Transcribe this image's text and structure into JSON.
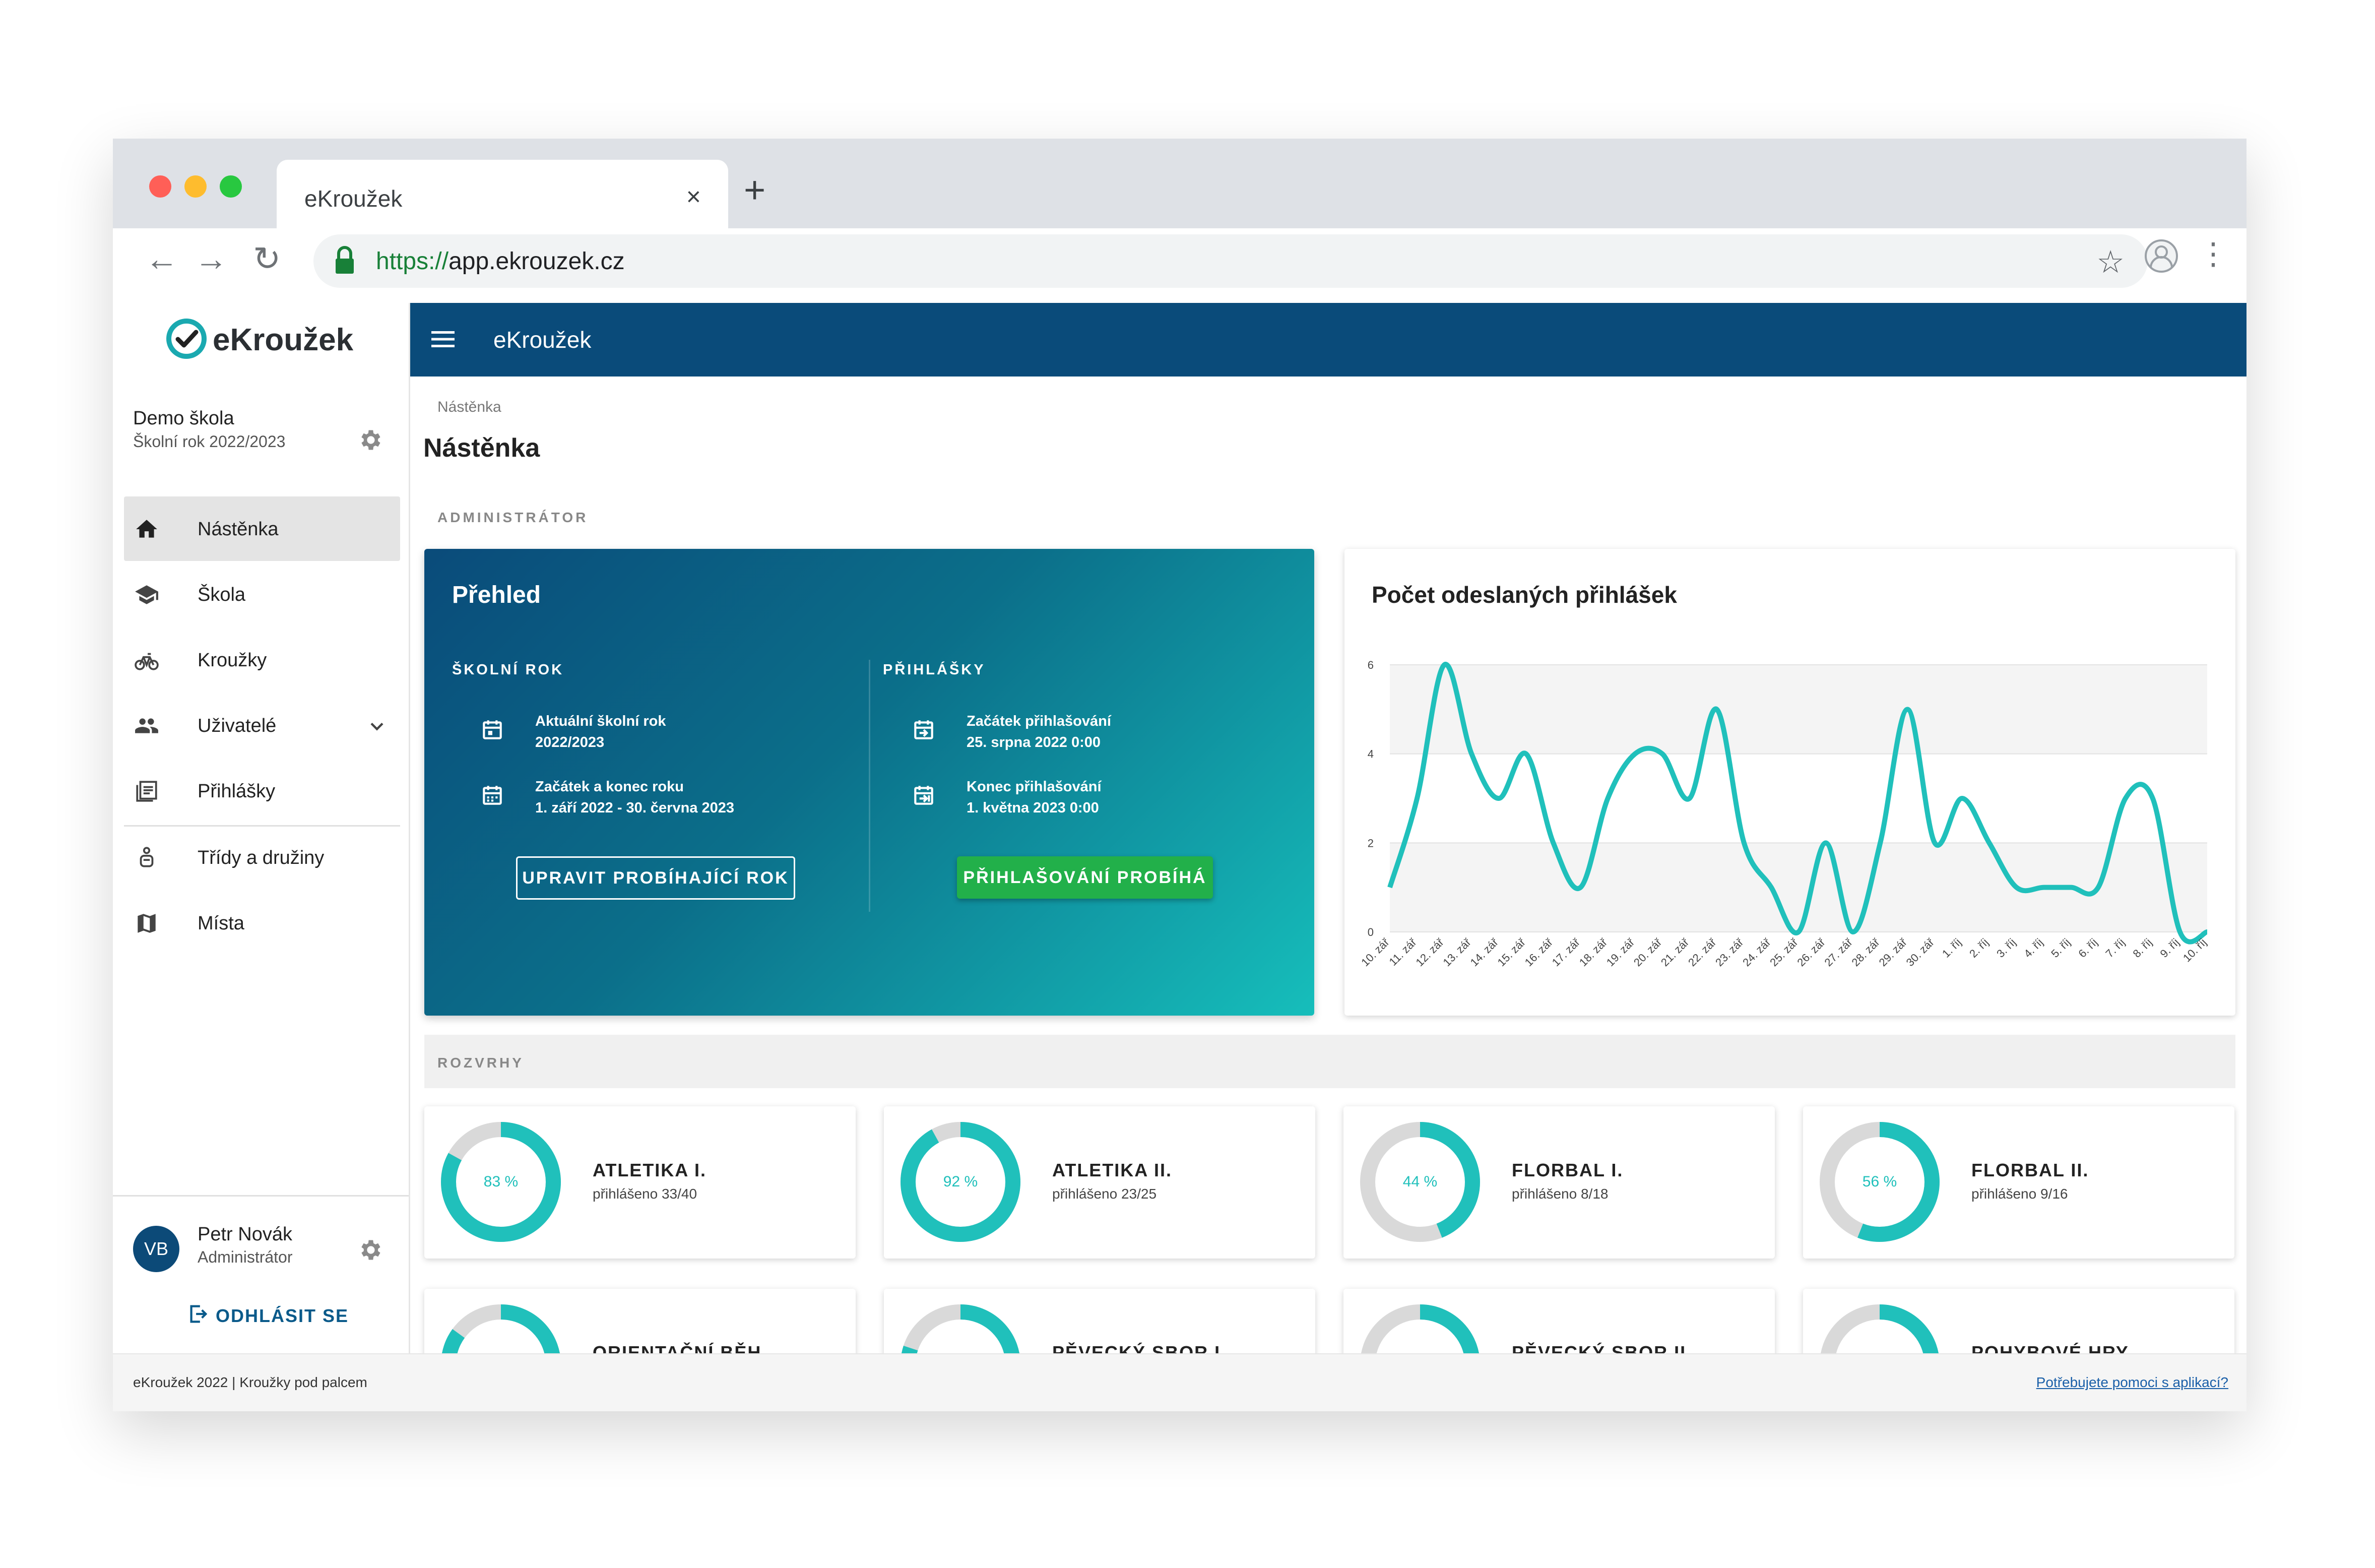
{
  "browser": {
    "tab_title": "eKroužek",
    "tab_close": "×",
    "new_tab": "+",
    "url_protocol": "https://",
    "url_rest": "app.ekrouzek.cz",
    "colors": {
      "red": "#ff5f57",
      "yellow": "#febc2e",
      "green": "#28c840"
    }
  },
  "sidebar": {
    "logo_text": "eKroužek",
    "school_name": "Demo škola",
    "school_year": "Školní rok 2022/2023",
    "items": [
      {
        "label": "Nástěnka",
        "icon": "home-icon",
        "active": true
      },
      {
        "label": "Škola",
        "icon": "school-icon"
      },
      {
        "label": "Kroužky",
        "icon": "bike-icon"
      },
      {
        "label": "Uživatelé",
        "icon": "users-icon"
      },
      {
        "label": "Přihlášky",
        "icon": "list-icon"
      },
      {
        "label": "Třídy a družiny",
        "icon": "child-icon"
      },
      {
        "label": "Místa",
        "icon": "map-icon"
      }
    ],
    "user": {
      "initials": "VB",
      "name": "Petr Novák",
      "role": "Administrátor"
    },
    "logout_label": "ODHLÁSIT SE"
  },
  "appbar": {
    "title": "eKroužek"
  },
  "main": {
    "breadcrumb": "Nástěnka",
    "page_title": "Nástěnka",
    "section_admin": "ADMINISTRÁTOR",
    "overview": {
      "title": "Přehled",
      "school_year_heading": "ŠKOLNÍ ROK",
      "applications_heading": "PŘIHLÁŠKY",
      "current_year_label": "Aktuální školní rok",
      "current_year_value": "2022/2023",
      "year_span_label": "Začátek a konec roku",
      "year_span_value": "1. září 2022 - 30. června 2023",
      "signup_start_label": "Začátek přihlašování",
      "signup_start_value": "25. srpna 2022 0:00",
      "signup_end_label": "Konec přihlašování",
      "signup_end_value": "1. května 2023 0:00",
      "edit_year_button": "UPRAVIT PROBÍHAJÍCÍ ROK",
      "signup_status_button": "PŘIHLAŠOVÁNÍ PROBÍHÁ"
    },
    "section_schedules": "ROZVRHY",
    "schedules": [
      {
        "name": "ATLETIKA I.",
        "count": "přihlášeno 33/40",
        "pct_label": "83 %",
        "fraction": 0.83
      },
      {
        "name": "ATLETIKA II.",
        "count": "přihlášeno 23/25",
        "pct_label": "92 %",
        "fraction": 0.92
      },
      {
        "name": "FLORBAL I.",
        "count": "přihlášeno 8/18",
        "pct_label": "44 %",
        "fraction": 0.44
      },
      {
        "name": "FLORBAL II.",
        "count": "přihlášeno 9/16",
        "pct_label": "56 %",
        "fraction": 0.56
      },
      {
        "name": "ORIENTAČNÍ BĚH",
        "count": "",
        "pct_label": "",
        "fraction": 0.85
      },
      {
        "name": "PĚVECKÝ SBOR I.",
        "count": "",
        "pct_label": "",
        "fraction": 0.8
      },
      {
        "name": "PĚVECKÝ SBOR II.",
        "count": "",
        "pct_label": "",
        "fraction": 0.6
      },
      {
        "name": "POHYBOVÉ HRY LYČKÁRNA",
        "count": "",
        "pct_label": "",
        "fraction": 0.7
      }
    ],
    "accent_color": "#20c0bb",
    "track_color": "#d9d9d9"
  },
  "chart_data": {
    "type": "line",
    "title": "Počet odeslaných přihlášek",
    "categories": [
      "10. zář",
      "11. zář",
      "12. zář",
      "13. zář",
      "14. zář",
      "15. zář",
      "16. zář",
      "17. zář",
      "18. zář",
      "19. zář",
      "20. zář",
      "21. zář",
      "22. zář",
      "23. zář",
      "24. zář",
      "25. zář",
      "26. zář",
      "27. zář",
      "28. zář",
      "29. zář",
      "30. zář",
      "1. říj",
      "2. říj",
      "3. říj",
      "4. říj",
      "5. říj",
      "6. říj",
      "7. říj",
      "8. říj",
      "9. říj",
      "10. říj"
    ],
    "values": [
      1,
      3,
      6,
      4,
      3,
      4,
      2,
      1,
      3,
      4,
      4,
      3,
      5,
      2,
      1,
      0,
      2,
      0,
      2,
      5,
      2,
      3,
      2,
      1,
      1,
      1,
      1,
      3,
      3,
      0,
      0
    ],
    "yticks": [
      0,
      2,
      4,
      6
    ],
    "ylim": [
      0,
      6
    ],
    "grid": true,
    "color": "#20c0bb"
  },
  "footer": {
    "left": "eKroužek 2022 | Kroužky pod palcem",
    "right": "Potřebujete pomoci s aplikací?"
  }
}
